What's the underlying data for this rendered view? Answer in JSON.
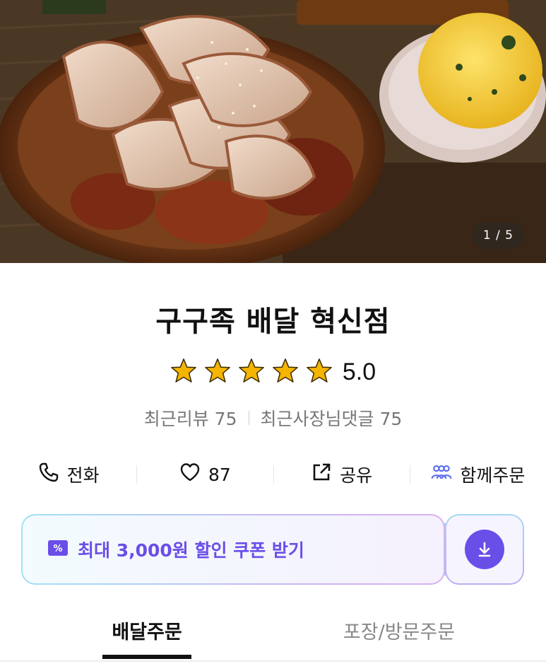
{
  "hero": {
    "counter": "1 / 5",
    "image_desc": ""
  },
  "store": {
    "name": "구구족 배달 혁신점",
    "rating": 5.0,
    "rating_label": "5.0",
    "star_count": 5
  },
  "reviews": {
    "recent_reviews": "최근리뷰 75",
    "owner_replies": "최근사장님댓글 75"
  },
  "actions": [
    {
      "icon": "phone-icon",
      "label": "전화"
    },
    {
      "icon": "heart-icon",
      "label": "87"
    },
    {
      "icon": "share-icon",
      "label": "공유"
    },
    {
      "icon": "group-order-icon",
      "label": "함께주문"
    }
  ],
  "coupon": {
    "label": "최대 3,000원 할인 쿠폰 받기",
    "icon": "coupon-icon",
    "button_icon": "download-icon"
  },
  "tabs": {
    "delivery": "배달주문",
    "pickup": "포장/방문주문",
    "active": "delivery"
  },
  "colors": {
    "accent": "#6a4ee8",
    "star": "#f5b400"
  }
}
